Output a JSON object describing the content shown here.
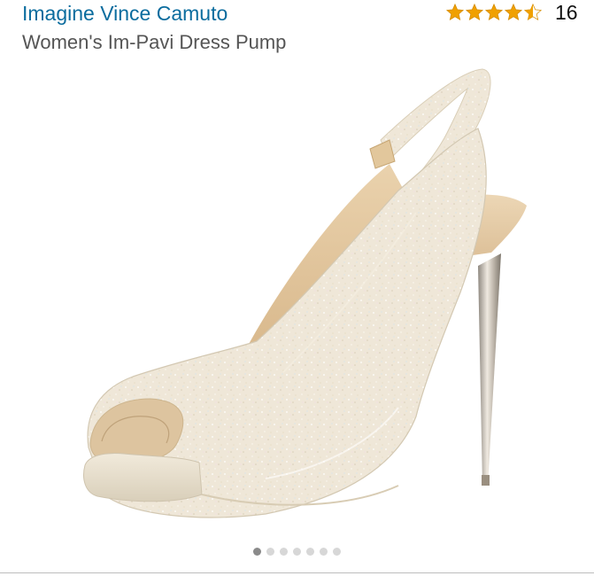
{
  "product": {
    "brand": "Imagine Vince Camuto",
    "title": "Women's Im-Pavi Dress Pump",
    "rating": {
      "stars": 4.5,
      "max_stars": 5,
      "review_count": "16",
      "star_color": "#f0a000"
    },
    "image": {
      "icon": "glitter-slingback-heel-image",
      "colors": {
        "upper": "#efe6d6",
        "lining": "#e4c49a",
        "heel": "#c9c2b8",
        "platform": "#ece3cf"
      }
    },
    "carousel": {
      "total": 7,
      "active_index": 0
    }
  }
}
